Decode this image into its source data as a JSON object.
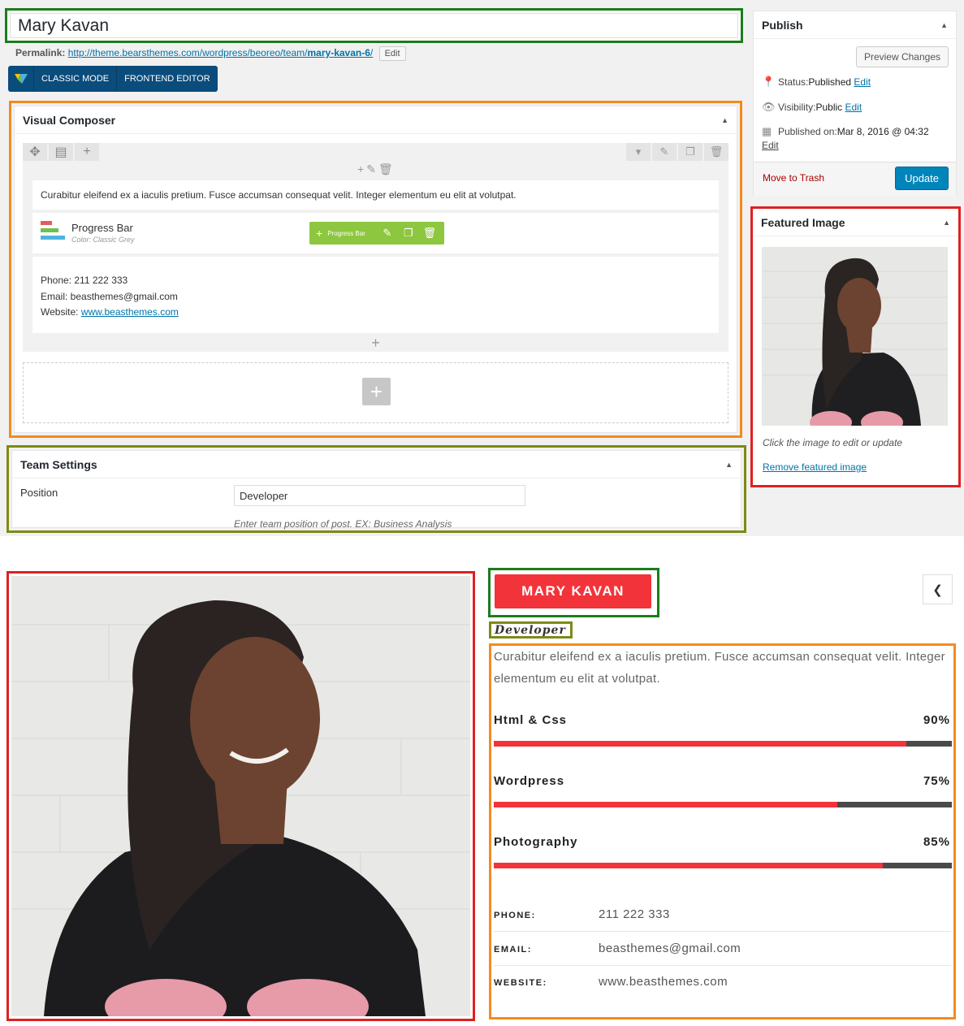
{
  "admin": {
    "title_value": "Mary Kavan",
    "permalink": {
      "label": "Permalink:",
      "url_base": "http://theme.bearsthemes.com/wordpress/beoreo/team/",
      "slug": "mary-kavan-6",
      "url_end": "/",
      "edit": "Edit"
    },
    "vc_modes": [
      "CLASSIC MODE",
      "FRONTEND EDITOR"
    ],
    "visual_composer": {
      "title": "Visual Composer",
      "text_block": "Curabitur eleifend ex a iaculis pretium. Fusce accumsan consequat velit. Integer elementum eu elit at volutpat.",
      "progress_bar": {
        "title": "Progress Bar",
        "subtitle": "Color: Classic Grey",
        "toolbar_label": "Progress Bar",
        "icon_colors": [
          "#e85a5a",
          "#6cc24a",
          "#4fb3e0"
        ]
      },
      "contact": {
        "phone": "Phone: 211 222 333",
        "email": "Email: beasthemes@gmail.com",
        "website_label": "Website: ",
        "website": "www.beasthemes.com"
      }
    },
    "team_settings": {
      "title": "Team Settings",
      "position_label": "Position",
      "position_value": "Developer",
      "help": "Enter team position of post. EX: Business Analysis"
    },
    "publish": {
      "title": "Publish",
      "preview": "Preview Changes",
      "status_label": "Status: ",
      "status_value": "Published",
      "visibility_label": "Visibility: ",
      "visibility_value": "Public",
      "published_label": "Published on: ",
      "published_value": "Mar 8, 2016 @ 04:32",
      "edit": "Edit",
      "trash": "Move to Trash",
      "update": "Update"
    },
    "featured_image": {
      "title": "Featured Image",
      "help": "Click the image to edit or update",
      "remove": "Remove featured image"
    }
  },
  "front": {
    "name": "MARY KAVAN",
    "role": "Developer",
    "description": "Curabitur eleifend ex a iaculis pretium. Fusce accumsan consequat velit. Integer elementum eu elit at volutpat.",
    "skills": [
      {
        "name": "Html & Css",
        "percent_label": "90%",
        "value": 0.9
      },
      {
        "name": "Wordpress",
        "percent_label": "75%",
        "value": 0.75
      },
      {
        "name": "Photography",
        "percent_label": "85%",
        "value": 0.85
      }
    ],
    "info": [
      {
        "label": "PHONE:",
        "value": "211 222 333"
      },
      {
        "label": "EMAIL:",
        "value": "beasthemes@gmail.com"
      },
      {
        "label": "WEBSITE:",
        "value": "www.beasthemes.com"
      }
    ],
    "colors": {
      "accent": "#f3333a",
      "track": "#4a4a4a"
    }
  }
}
